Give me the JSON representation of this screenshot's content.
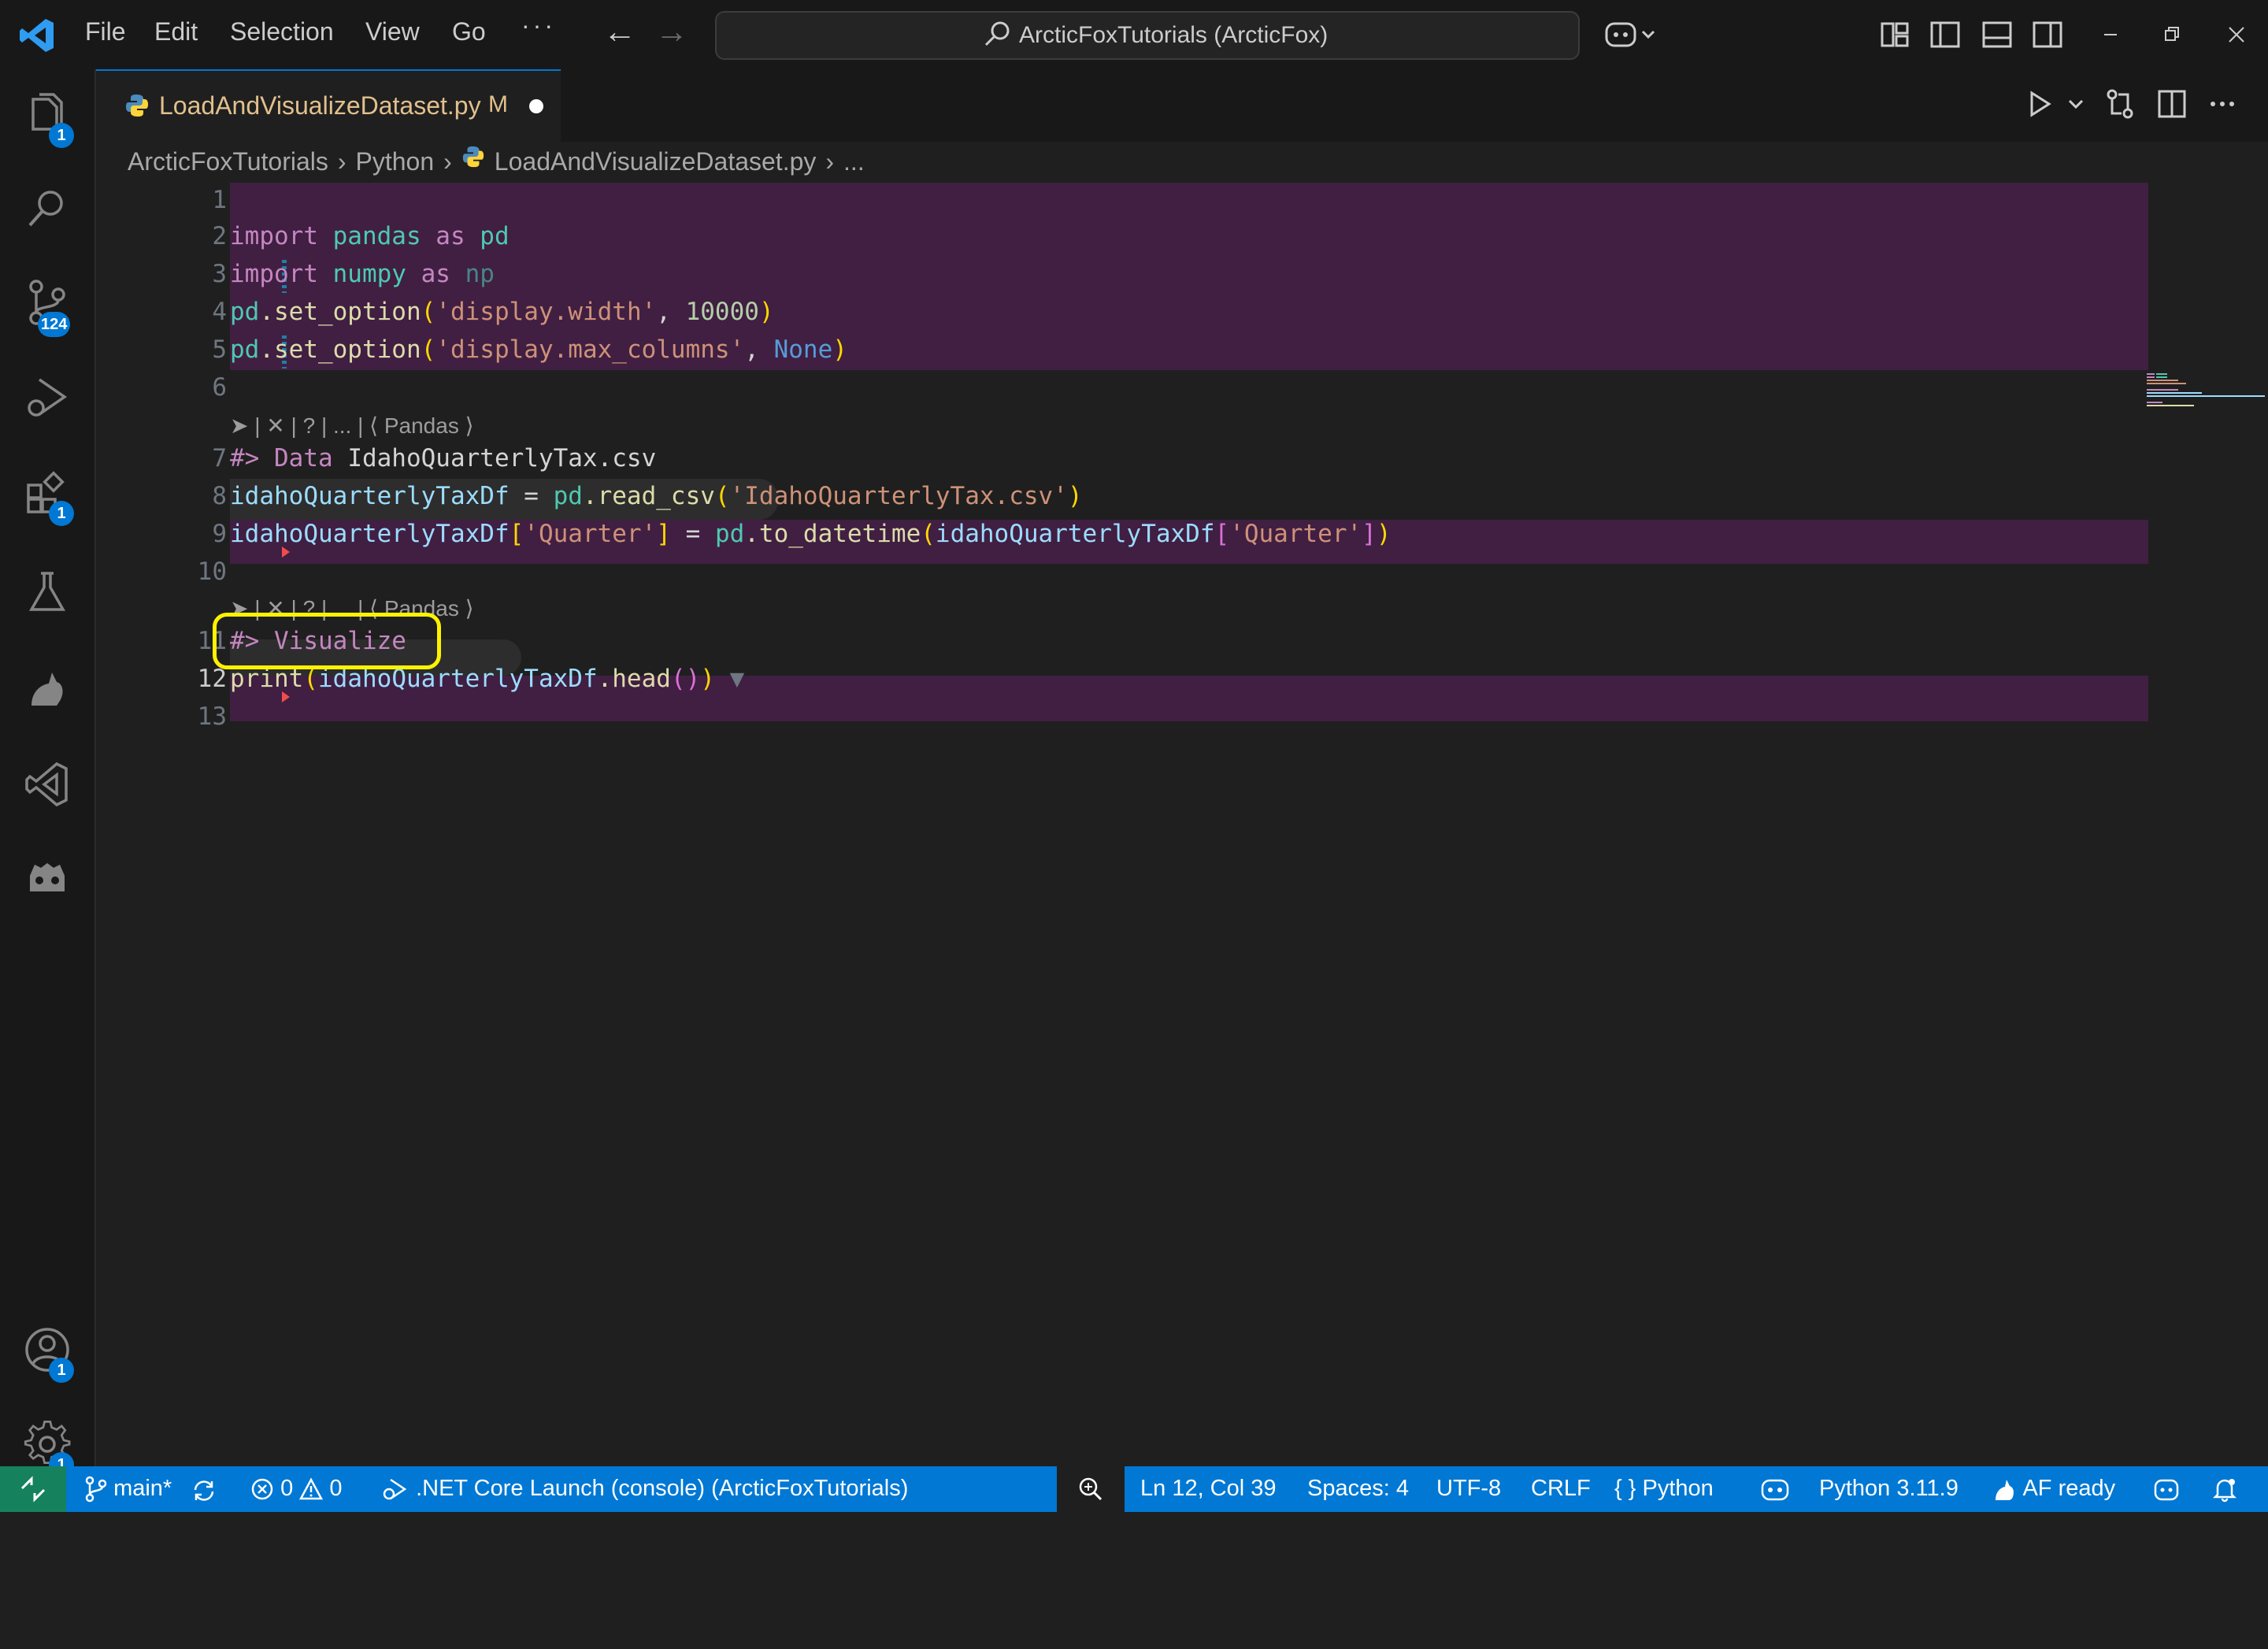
{
  "titlebar": {
    "menu": [
      "File",
      "Edit",
      "Selection",
      "View",
      "Go",
      "···"
    ],
    "nav_back": "←",
    "nav_forward": "→",
    "command_center": "ArcticFoxTutorials (ArcticFox)"
  },
  "activitybar": {
    "items": [
      {
        "name": "explorer-icon",
        "badge": "1"
      },
      {
        "name": "search-icon",
        "badge": ""
      },
      {
        "name": "source-control-icon",
        "badge": "124"
      },
      {
        "name": "run-debug-icon",
        "badge": ""
      },
      {
        "name": "extensions-icon",
        "badge": "1"
      },
      {
        "name": "testing-icon",
        "badge": ""
      },
      {
        "name": "arcticfox-icon",
        "badge": ""
      },
      {
        "name": "visual-studio-icon",
        "badge": ""
      },
      {
        "name": "godot-icon",
        "badge": ""
      }
    ],
    "accounts_badge": "1",
    "settings_badge": "1"
  },
  "tab": {
    "filename": "LoadAndVisualizeDataset.py",
    "modified": "M"
  },
  "breadcrumb": {
    "items": [
      "ArcticFoxTutorials",
      "Python",
      "LoadAndVisualizeDataset.py",
      "..."
    ]
  },
  "editor": {
    "line_numbers": [
      "1",
      "2",
      "3",
      "4",
      "5",
      "6",
      "7",
      "8",
      "9",
      "10",
      "11",
      "12",
      "13"
    ],
    "active_line": "12",
    "codelens_1": "➤ | ✕ | ? | ... | ⟨ Pandas ⟩",
    "codelens_2": "➤ | ✕ | ? | ... | ⟨ Pandas ⟩",
    "lines": {
      "l2": {
        "t1": "import",
        "t2": " pandas ",
        "t3": "as",
        "t4": " pd"
      },
      "l3": {
        "t1": "import",
        "t2": " numpy ",
        "t3": "as",
        "t4": " np"
      },
      "l4": {
        "t1": "pd",
        "t2": ".set_option",
        "t3": "(",
        "t4": "'display.width'",
        "t5": ", ",
        "t6": "10000",
        "t7": ")"
      },
      "l5": {
        "t1": "pd",
        "t2": ".set_option",
        "t3": "(",
        "t4": "'display.max_columns'",
        "t5": ", ",
        "t6": "None",
        "t7": ")"
      },
      "l7": {
        "t1": "#> Data ",
        "t2": "IdahoQuarterlyTax.csv"
      },
      "l8": {
        "t1": "idahoQuarterlyTaxDf",
        "t2": " = ",
        "t3": "pd",
        "t4": ".read_csv",
        "t5": "(",
        "t6": "'IdahoQuarterlyTax.csv'",
        "t7": ")"
      },
      "l9": {
        "t1": "idahoQuarterlyTaxDf",
        "t2": "[",
        "t3": "'Quarter'",
        "t4": "]",
        "t5": " = ",
        "t6": "pd",
        "t7": ".to_datetime",
        "t8": "(",
        "t9": "idahoQuarterlyTaxDf",
        "t10": "[",
        "t11": "'Quarter'",
        "t12": "]",
        "t13": ")"
      },
      "l11": {
        "t1": "#> Visualize"
      },
      "l12": {
        "t1": "print",
        "t2": "(",
        "t3": "idahoQuarterlyTaxDf",
        "t4": ".head",
        "t5": "()",
        "t6": ")",
        "t7": " ▼"
      }
    }
  },
  "statusbar": {
    "branch": "main*",
    "errors": "0",
    "warnings": "0",
    "launch": ".NET Core Launch (console) (ArcticFoxTutorials)",
    "cursor": "Ln 12, Col 39",
    "spaces": "Spaces: 4",
    "encoding": "UTF-8",
    "eol": "CRLF",
    "language": "Python",
    "interpreter": "Python 3.11.9",
    "af_status": "AF ready"
  },
  "colors": {
    "accent": "#0078d4",
    "cell_background": "#401f42",
    "highlight_ring": "#fff200",
    "remote": "#16825d"
  }
}
